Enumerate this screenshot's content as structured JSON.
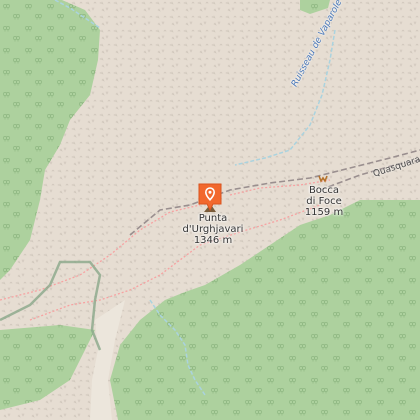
{
  "map": {
    "peak": {
      "name_line1": "Punta",
      "name_line2": "d'Urghjavari",
      "elevation": "1346 m"
    },
    "pass": {
      "name_line1": "Bocca",
      "name_line2": "di Foce",
      "elevation": "1159 m"
    },
    "stream_label": "Ruisseau de Vaparole",
    "road_label": "Quasquara",
    "marker_icon": "map-pin-icon",
    "colors": {
      "rock": "#e6ddd2",
      "forest": "#add19e",
      "stream": "#aad3df",
      "marker": "#f2682d",
      "track": "#9a8f8f",
      "path": "#f7a2a2"
    }
  }
}
